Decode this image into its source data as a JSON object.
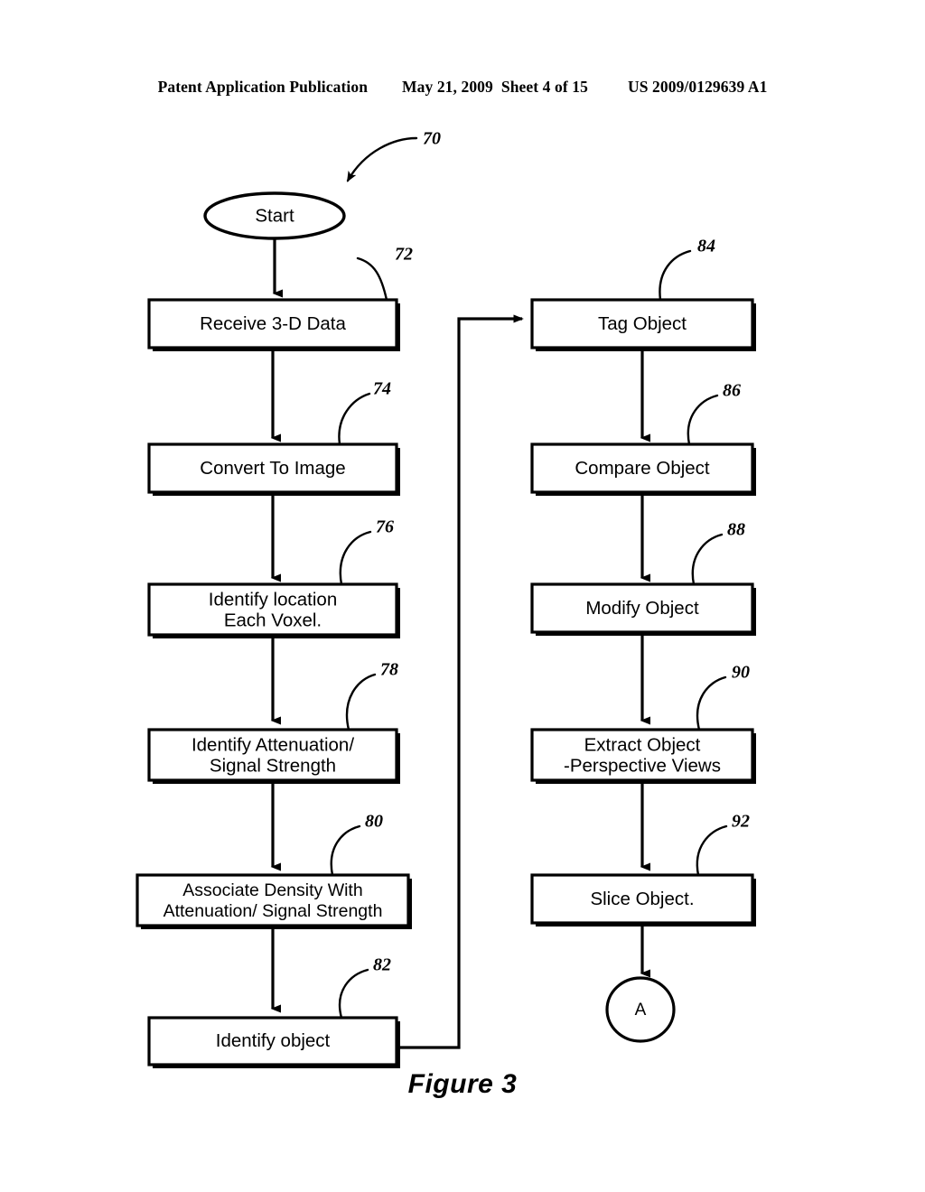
{
  "header": {
    "publication": "Patent Application Publication",
    "date": "May 21, 2009",
    "sheet": "Sheet 4 of 15",
    "patent_number": "US 2009/0129639 A1"
  },
  "figure": {
    "caption": "Figure 3",
    "overall_reference": "70"
  },
  "flowchart": {
    "start_node": {
      "label": "Start"
    },
    "connector_node": {
      "label": "A"
    },
    "left_column": [
      {
        "label_line1": "Receive 3-D Data",
        "label_line2": "",
        "ref": "72"
      },
      {
        "label_line1": "Convert To Image",
        "label_line2": "",
        "ref": "74"
      },
      {
        "label_line1": "Identify location",
        "label_line2": "Each Voxel.",
        "ref": "76"
      },
      {
        "label_line1": "Identify Attenuation/",
        "label_line2": "Signal Strength",
        "ref": "78"
      },
      {
        "label_line1": "Associate Density With",
        "label_line2": "Attenuation/ Signal Strength",
        "ref": "80"
      },
      {
        "label_line1": "Identify object",
        "label_line2": "",
        "ref": "82"
      }
    ],
    "right_column": [
      {
        "label_line1": "Tag Object",
        "label_line2": "",
        "ref": "84"
      },
      {
        "label_line1": "Compare Object",
        "label_line2": "",
        "ref": "86"
      },
      {
        "label_line1": "Modify Object",
        "label_line2": "",
        "ref": "88"
      },
      {
        "label_line1": "Extract Object",
        "label_line2": "-Perspective Views",
        "ref": "90"
      },
      {
        "label_line1": "Slice Object.",
        "label_line2": "",
        "ref": "92"
      }
    ]
  },
  "colors": {
    "ink": "#000000",
    "paper": "#ffffff"
  }
}
